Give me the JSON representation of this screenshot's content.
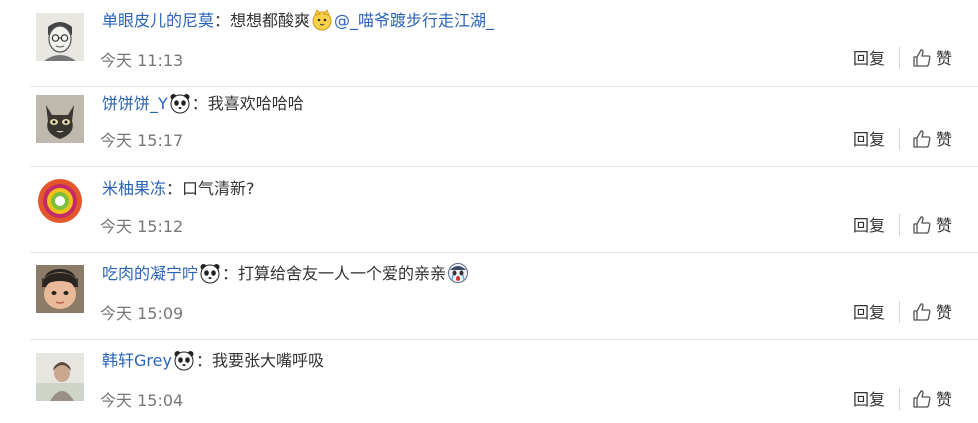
{
  "colon": "：",
  "reply_label": "回复",
  "like_label": "赞",
  "comments": [
    {
      "user": "单眼皮儿的尼莫",
      "text": "想想都酸爽",
      "mention": "@_喵爷踱步行走江湖_",
      "time": "今天 11:13",
      "emoji": "cat-emoji"
    },
    {
      "user": "饼饼饼_Y",
      "text": "我喜欢哈哈哈",
      "time": "今天 15:17",
      "emoji": "panda-emoji"
    },
    {
      "user": "米柚果冻",
      "text": "口气清新?",
      "time": "今天 15:12"
    },
    {
      "user": "吃肉的凝宁咛",
      "text": "打算给舍友一人一个爱的亲亲",
      "time": "今天 15:09",
      "emoji": "panda-emoji",
      "trailing_emoji": "crying-face-emoji"
    },
    {
      "user": "韩轩Grey",
      "text": "我要张大嘴呼吸",
      "time": "今天 15:04",
      "emoji": "panda-emoji"
    }
  ]
}
